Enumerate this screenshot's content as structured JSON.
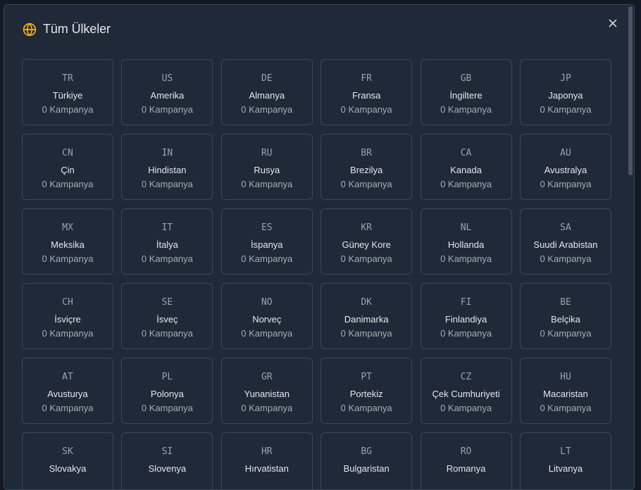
{
  "dialog": {
    "title": "Tüm Ülkeler",
    "icon": "globe-icon",
    "close_icon": "close-icon",
    "accent": "#f5b70a"
  },
  "countries": [
    {
      "code": "TR",
      "name": "Türkiye",
      "count": "0 Kampanya"
    },
    {
      "code": "US",
      "name": "Amerika",
      "count": "0 Kampanya"
    },
    {
      "code": "DE",
      "name": "Almanya",
      "count": "0 Kampanya"
    },
    {
      "code": "FR",
      "name": "Fransa",
      "count": "0 Kampanya"
    },
    {
      "code": "GB",
      "name": "İngiltere",
      "count": "0 Kampanya"
    },
    {
      "code": "JP",
      "name": "Japonya",
      "count": "0 Kampanya"
    },
    {
      "code": "CN",
      "name": "Çin",
      "count": "0 Kampanya"
    },
    {
      "code": "IN",
      "name": "Hindistan",
      "count": "0 Kampanya"
    },
    {
      "code": "RU",
      "name": "Rusya",
      "count": "0 Kampanya"
    },
    {
      "code": "BR",
      "name": "Brezilya",
      "count": "0 Kampanya"
    },
    {
      "code": "CA",
      "name": "Kanada",
      "count": "0 Kampanya"
    },
    {
      "code": "AU",
      "name": "Avustralya",
      "count": "0 Kampanya"
    },
    {
      "code": "MX",
      "name": "Meksika",
      "count": "0 Kampanya"
    },
    {
      "code": "IT",
      "name": "İtalya",
      "count": "0 Kampanya"
    },
    {
      "code": "ES",
      "name": "İspanya",
      "count": "0 Kampanya"
    },
    {
      "code": "KR",
      "name": "Güney Kore",
      "count": "0 Kampanya"
    },
    {
      "code": "NL",
      "name": "Hollanda",
      "count": "0 Kampanya"
    },
    {
      "code": "SA",
      "name": "Suudi Arabistan",
      "count": "0 Kampanya"
    },
    {
      "code": "CH",
      "name": "İsviçre",
      "count": "0 Kampanya"
    },
    {
      "code": "SE",
      "name": "İsveç",
      "count": "0 Kampanya"
    },
    {
      "code": "NO",
      "name": "Norveç",
      "count": "0 Kampanya"
    },
    {
      "code": "DK",
      "name": "Danimarka",
      "count": "0 Kampanya"
    },
    {
      "code": "FI",
      "name": "Finlandiya",
      "count": "0 Kampanya"
    },
    {
      "code": "BE",
      "name": "Belçika",
      "count": "0 Kampanya"
    },
    {
      "code": "AT",
      "name": "Avusturya",
      "count": "0 Kampanya"
    },
    {
      "code": "PL",
      "name": "Polonya",
      "count": "0 Kampanya"
    },
    {
      "code": "GR",
      "name": "Yunanistan",
      "count": "0 Kampanya"
    },
    {
      "code": "PT",
      "name": "Portekiz",
      "count": "0 Kampanya"
    },
    {
      "code": "CZ",
      "name": "Çek Cumhuriyeti",
      "count": "0 Kampanya"
    },
    {
      "code": "HU",
      "name": "Macaristan",
      "count": "0 Kampanya"
    },
    {
      "code": "SK",
      "name": "Slovakya"
    },
    {
      "code": "SI",
      "name": "Slovenya"
    },
    {
      "code": "HR",
      "name": "Hırvatistan"
    },
    {
      "code": "BG",
      "name": "Bulgaristan"
    },
    {
      "code": "RO",
      "name": "Romanya"
    },
    {
      "code": "LT",
      "name": "Litvanya"
    }
  ]
}
